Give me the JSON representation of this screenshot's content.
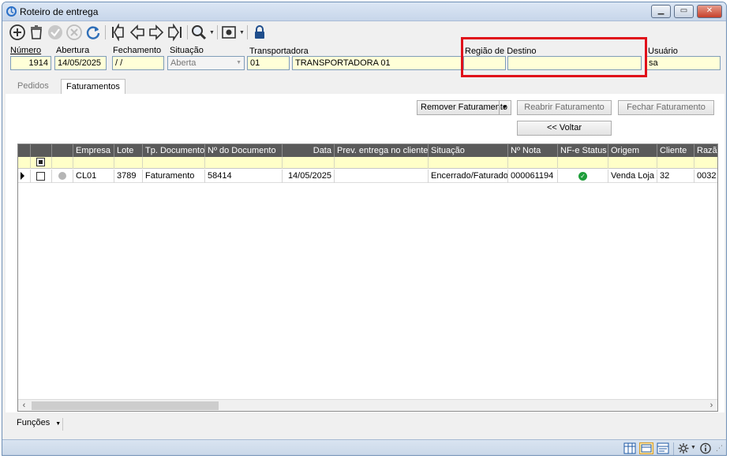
{
  "window": {
    "title": "Roteiro de entrega"
  },
  "labels": {
    "numero": "Número",
    "abertura": "Abertura",
    "fechamento": "Fechamento",
    "situacao": "Situação",
    "transportadora": "Transportadora",
    "regiao_destino": "Região de Destino",
    "usuario": "Usuário"
  },
  "form": {
    "numero": "1914",
    "abertura": "14/05/2025",
    "fechamento": " / /",
    "situacao": "Aberta",
    "transportadora_codigo": "01",
    "transportadora_nome": "TRANSPORTADORA 01",
    "regiao_codigo": "",
    "regiao_nome": "",
    "usuario": "sa"
  },
  "tabs": [
    {
      "label": "Pedidos",
      "active": false
    },
    {
      "label": "Faturamentos",
      "active": true
    }
  ],
  "buttons": {
    "remover": "Remover Faturamento",
    "reabrir": "Reabrir Faturamento",
    "fechar": "Fechar Faturamento",
    "voltar": "<< Voltar"
  },
  "grid": {
    "columns": [
      "Empresa",
      "Lote",
      "Tp. Documento",
      "Nº do Documento",
      "Data",
      "Prev. entrega no cliente",
      "Situação",
      "Nº Nota",
      "NF-e Status",
      "Origem",
      "Cliente",
      "Razão"
    ],
    "rows": [
      {
        "empresa": "CL01",
        "lote": "3789",
        "tp_documento": "Faturamento",
        "num_documento": "58414",
        "data": "14/05/2025",
        "prev_entrega": "",
        "situacao": "Encerrado/Faturado",
        "num_nota": "000061194",
        "nfe_status": "ok",
        "origem": "Venda Loja",
        "cliente": "32",
        "razao": "0032"
      }
    ]
  },
  "footer": {
    "funcoes": "Funções"
  },
  "colors": {
    "filter_bg": "#ffffc8",
    "field_bg": "#ffffd8",
    "header_bg": "#5a5a5a",
    "highlight": "#e0101a",
    "ok": "#1e9e3a"
  }
}
